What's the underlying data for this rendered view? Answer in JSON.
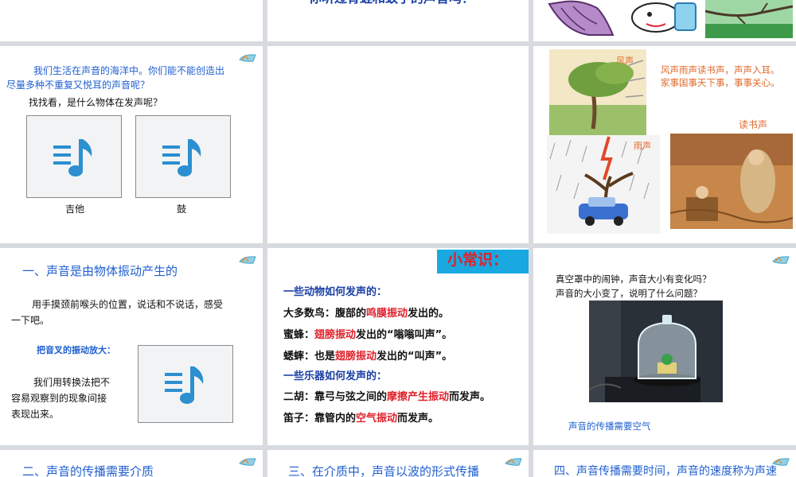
{
  "slides": {
    "s2": {
      "text": "你听过青蛙和蚊子的声音吗？"
    },
    "s4": {
      "intro": [
        "我们生活在声音的海洋中。你们能不能创造出",
        "尽量多种不重复又悦耳的声音呢？"
      ],
      "prompt": "找找看，是什么物体在发声呢？",
      "audio1_label": "吉他",
      "audio2_label": "鼓"
    },
    "s6": {
      "caption_wind": "风声",
      "caption_rain": "雨声",
      "caption_read": "读书声",
      "poem": [
        "风声雨声读书声，声声入耳。",
        "家事国事天下事，事事关心。"
      ]
    },
    "s7": {
      "title": "一、声音是由物体振动产生的",
      "p1": [
        "用手摸颈前喉头的位置，说话和不说话，感受",
        "一下吧。"
      ],
      "fork": "把音叉的振动放大：",
      "p2": [
        "我们用转换法把不",
        "容易观察到的现象间接",
        "表现出来。"
      ]
    },
    "s8": {
      "badge": "小常识：",
      "h1": "一些动物如何发声的：",
      "l1": {
        "a": "大多数鸟：腹部的",
        "b": "鸣膜振动",
        "c": "发出的。"
      },
      "l2": {
        "a": "蜜蜂：",
        "b": "翅膀振动",
        "c": "发出的“嗡嗡叫声”。"
      },
      "l3": {
        "a": "蟋蟀：也是",
        "b": "翅膀振动",
        "c": "发出的“叫声”。"
      },
      "h2": "一些乐器如何发声的：",
      "l4": {
        "a": "二胡：靠弓与弦之间的",
        "b": "摩擦产生振动",
        "c": "而发声。"
      },
      "l5": {
        "a": "笛子：靠管内的",
        "b": "空气振动",
        "c": "而发声。"
      }
    },
    "s9": {
      "q1": "真空罩中的闹钟，声音大小有变化吗？",
      "q2": "声音的大小变了，说明了什么问题？",
      "conclusion": "声音的传播需要空气"
    },
    "s10": {
      "title": "二、声音的传播需要介质"
    },
    "s11": {
      "title": "三、在介质中，声音以波的形式传播"
    },
    "s12": {
      "title": "四、声音传播需要时间，声音的速度称为声速"
    }
  },
  "colors": {
    "accent_blue": "#1f5fd0",
    "red": "#e0202a",
    "badge_bg": "#19a8e0",
    "badge_text": "#e0202a"
  }
}
